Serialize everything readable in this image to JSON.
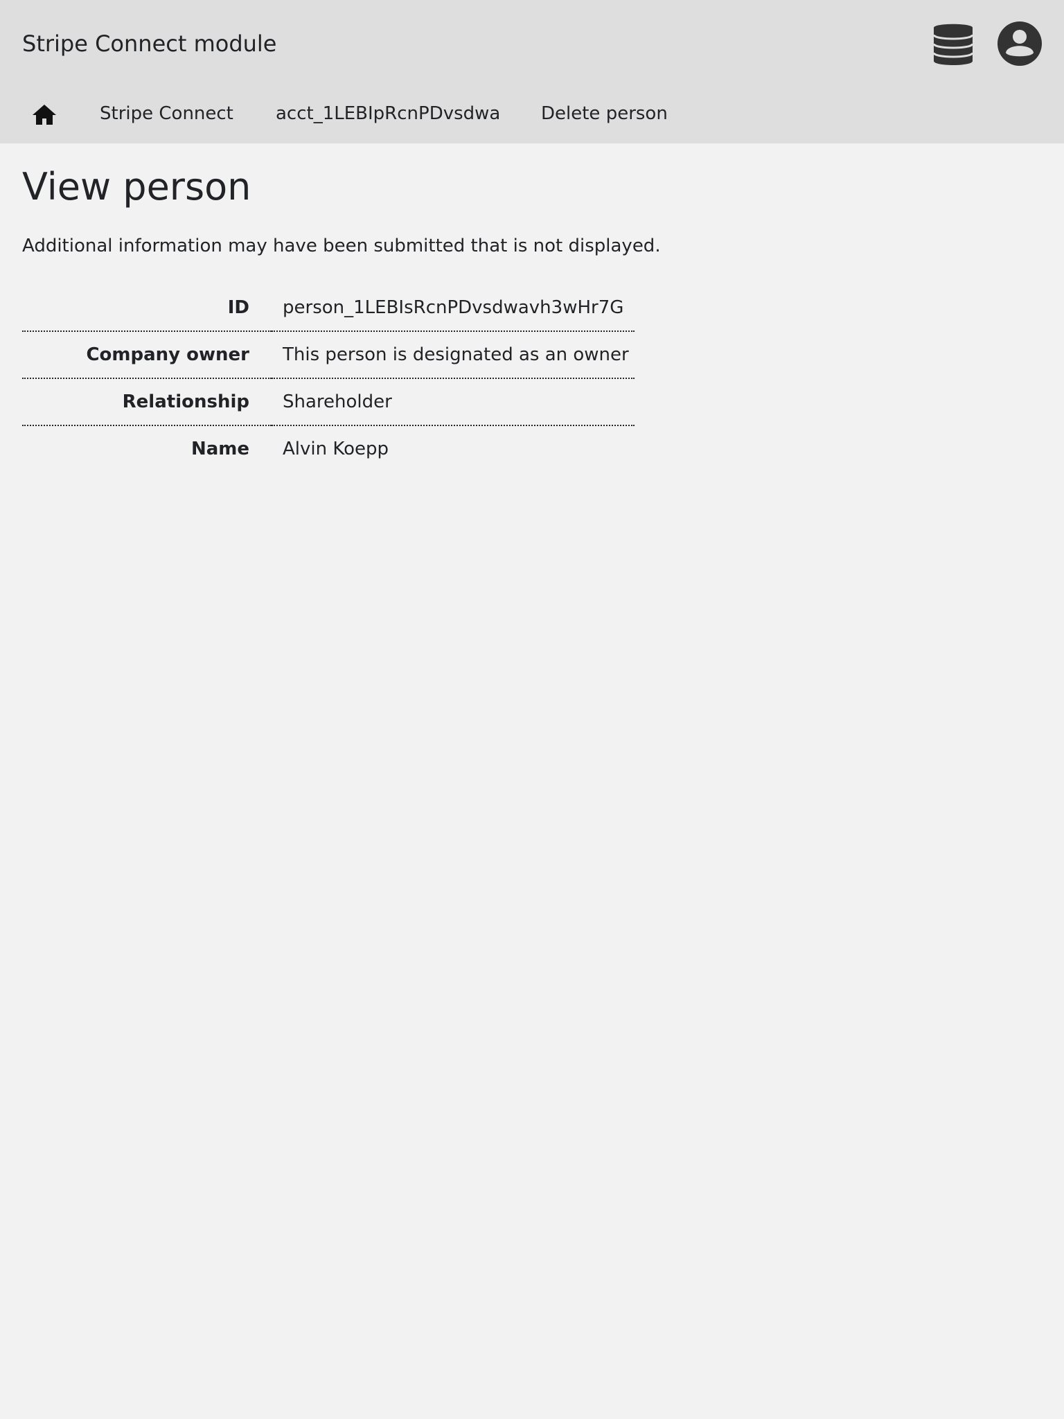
{
  "header": {
    "app_title": "Stripe Connect module",
    "icons": {
      "storage": "database-icon",
      "account": "account-circle-icon"
    },
    "colors": {
      "header_background": "#dedede",
      "page_background": "#f2f2f2",
      "icon": "#333333"
    }
  },
  "breadcrumb": {
    "home_icon": "home-icon",
    "items": [
      {
        "label": "Stripe Connect"
      },
      {
        "label": "acct_1LEBIpRcnPDvsdwa"
      },
      {
        "label": "Delete person"
      }
    ]
  },
  "main": {
    "title": "View person",
    "note": "Additional information may have been submitted that is not displayed.",
    "details": [
      {
        "label": "ID",
        "value": "person_1LEBIsRcnPDvsdwavh3wHr7G"
      },
      {
        "label": "Company owner",
        "value": "This person is designated as an owner"
      },
      {
        "label": "Relationship",
        "value": "Shareholder"
      },
      {
        "label": "Name",
        "value": "Alvin Koepp"
      }
    ]
  }
}
